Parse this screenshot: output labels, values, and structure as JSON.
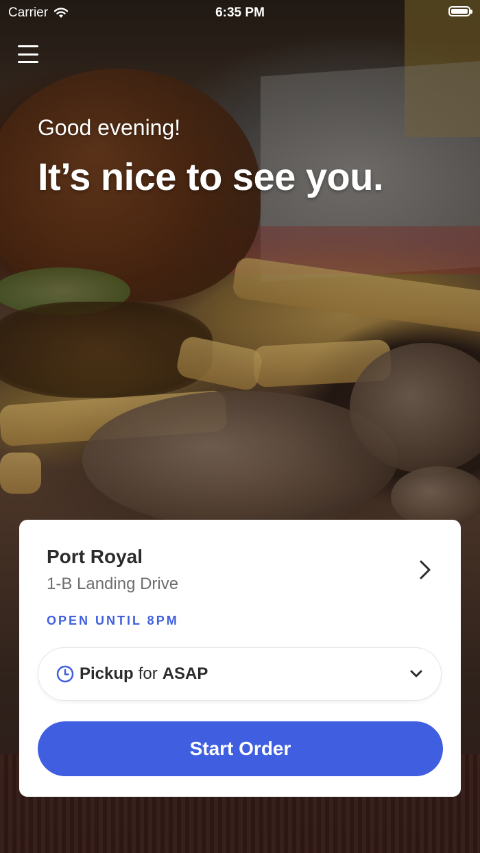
{
  "status_bar": {
    "carrier": "Carrier",
    "time": "6:35 PM"
  },
  "header": {
    "menu_icon": "hamburger-menu-icon",
    "greeting": "Good evening!",
    "headline": "It’s nice to see you."
  },
  "location": {
    "name": "Port Royal",
    "address": "1-B Landing Drive",
    "hours_status": "OPEN UNTIL 8PM"
  },
  "order_mode": {
    "icon": "clock-icon",
    "mode": "Pickup",
    "connector": "for",
    "time": "ASAP"
  },
  "start_order": {
    "label": "Start Order"
  },
  "colors": {
    "accent": "#3f5fe0",
    "card_bg": "#ffffff",
    "title_text": "#2b2b2b",
    "secondary_text": "#6e6e6e"
  }
}
